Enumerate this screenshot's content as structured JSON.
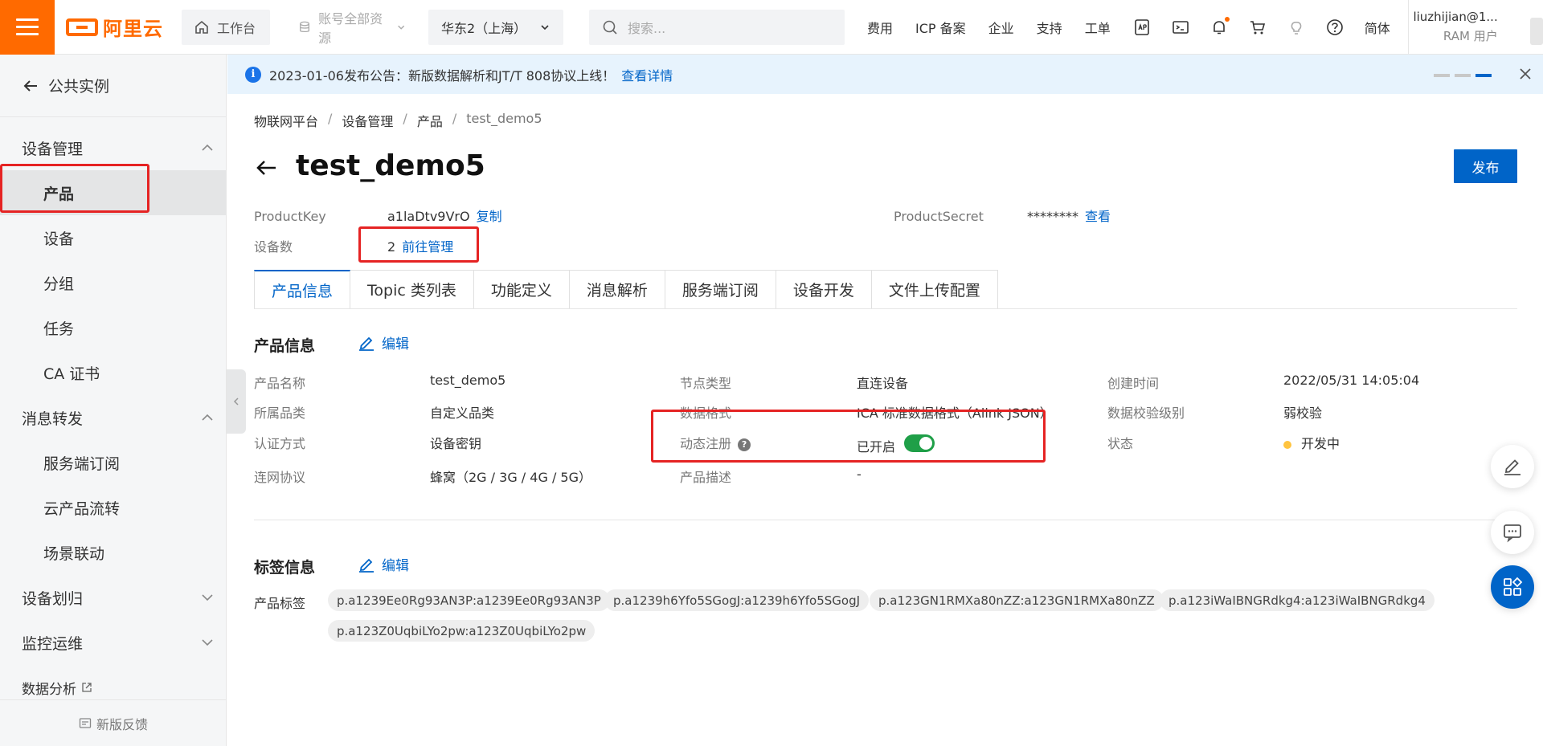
{
  "topbar": {
    "logo_text": "阿里云",
    "workbench": "工作台",
    "resources": "账号全部资源",
    "region": "华东2（上海）",
    "search_placeholder": "搜索...",
    "links": [
      "费用",
      "ICP 备案",
      "企业",
      "支持",
      "工单"
    ],
    "lang": "简体",
    "user_name": "liuzhijian@1...",
    "user_role": "RAM 用户"
  },
  "sidebar": {
    "back": "公共实例",
    "group_device": "设备管理",
    "device_items": [
      "产品",
      "设备",
      "分组",
      "任务",
      "CA 证书"
    ],
    "group_message": "消息转发",
    "message_items": [
      "服务端订阅",
      "云产品流转",
      "场景联动"
    ],
    "group_assign": "设备划归",
    "group_monitor": "监控运维",
    "data_analysis": "数据分析",
    "feedback": "新版反馈"
  },
  "notice": {
    "text": "2023-01-06发布公告：新版数据解析和JT/T 808协议上线！",
    "link": "查看详情"
  },
  "breadcrumb": [
    "物联网平台",
    "设备管理",
    "产品",
    "test_demo5"
  ],
  "product": {
    "title": "test_demo5",
    "publish": "发布",
    "product_key_label": "ProductKey",
    "product_key": "a1laDtv9VrO",
    "copy": "复制",
    "product_secret_label": "ProductSecret",
    "product_secret": "********",
    "view": "查看",
    "device_count_label": "设备数",
    "device_count": "2",
    "manage": "前往管理"
  },
  "tabs": [
    "产品信息",
    "Topic 类列表",
    "功能定义",
    "消息解析",
    "服务端订阅",
    "设备开发",
    "文件上传配置"
  ],
  "info_section": {
    "title": "产品信息",
    "edit": "编辑",
    "fields": {
      "name_label": "产品名称",
      "name": "test_demo5",
      "category_label": "所属品类",
      "category": "自定义品类",
      "auth_label": "认证方式",
      "auth": "设备密钥",
      "network_label": "连网协议",
      "network": "蜂窝（2G / 3G / 4G / 5G）",
      "node_label": "节点类型",
      "node": "直连设备",
      "format_label": "数据格式",
      "format": "ICA 标准数据格式（Alink JSON）",
      "dynreg_label": "动态注册",
      "dynreg": "已开启",
      "desc_label": "产品描述",
      "desc": "-",
      "created_label": "创建时间",
      "created": "2022/05/31 14:05:04",
      "verify_label": "数据校验级别",
      "verify": "弱校验",
      "status_label": "状态",
      "status": "开发中"
    }
  },
  "tag_section": {
    "title": "标签信息",
    "edit": "编辑",
    "label": "产品标签",
    "tags": [
      "p.a1239Ee0Rg93AN3P:a1239Ee0Rg93AN3P",
      "p.a1239h6Yfo5SGogJ:a1239h6Yfo5SGogJ",
      "p.a123GN1RMXa80nZZ:a123GN1RMXa80nZZ",
      "p.a123iWaIBNGRdkg4:a123iWaIBNGRdkg4",
      "p.a123Z0UqbiLYo2pw:a123Z0UqbiLYo2pw"
    ]
  },
  "colors": {
    "brand": "#ff6a00",
    "primary": "#0064c8",
    "highlight": "#e52323",
    "switch_on": "#1f9f48"
  }
}
